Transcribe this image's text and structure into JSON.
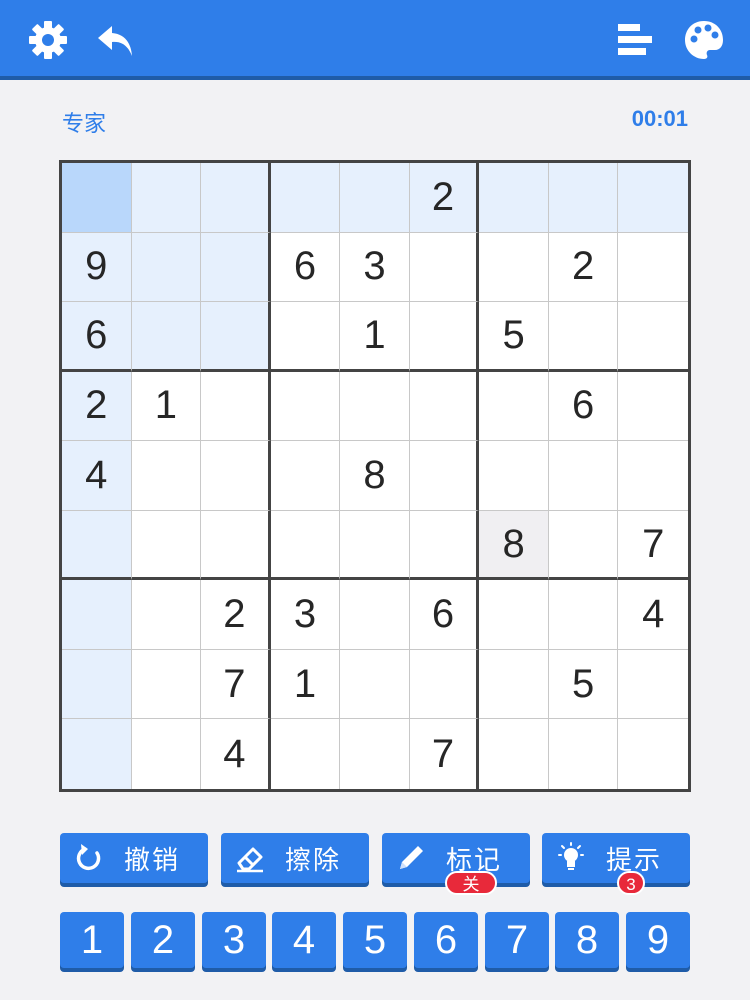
{
  "header": {
    "settings_icon": "gear-icon",
    "back_icon": "undo-arrow-icon",
    "stats_icon": "bars-icon",
    "theme_icon": "palette-icon",
    "accent_color": "#2f7ee9"
  },
  "status": {
    "difficulty": "专家",
    "timer": "00:01"
  },
  "board": {
    "rows": [
      [
        "",
        "",
        "",
        "",
        "",
        "2",
        "",
        "",
        ""
      ],
      [
        "9",
        "",
        "",
        "6",
        "3",
        "",
        "",
        "2",
        ""
      ],
      [
        "6",
        "",
        "",
        "",
        "1",
        "",
        "5",
        "",
        ""
      ],
      [
        "2",
        "1",
        "",
        "",
        "",
        "",
        "",
        "6",
        ""
      ],
      [
        "4",
        "",
        "",
        "",
        "8",
        "",
        "",
        "",
        ""
      ],
      [
        "",
        "",
        "",
        "",
        "",
        "",
        "8",
        "",
        "7"
      ],
      [
        "",
        "",
        "2",
        "3",
        "",
        "6",
        "",
        "",
        "4"
      ],
      [
        "",
        "",
        "7",
        "1",
        "",
        "",
        "",
        "5",
        ""
      ],
      [
        "",
        "",
        "4",
        "",
        "",
        "7",
        "",
        "",
        ""
      ]
    ],
    "selected_cell": [
      1,
      1
    ]
  },
  "actions": {
    "undo": {
      "label": "撤销",
      "icon": "undo-icon"
    },
    "erase": {
      "label": "擦除",
      "icon": "eraser-icon"
    },
    "notes": {
      "label": "标记",
      "icon": "pencil-icon",
      "badge": "关"
    },
    "hint": {
      "label": "提示",
      "icon": "lightbulb-icon",
      "badge": "3"
    }
  },
  "numpad": [
    "1",
    "2",
    "3",
    "4",
    "5",
    "6",
    "7",
    "8",
    "9"
  ]
}
